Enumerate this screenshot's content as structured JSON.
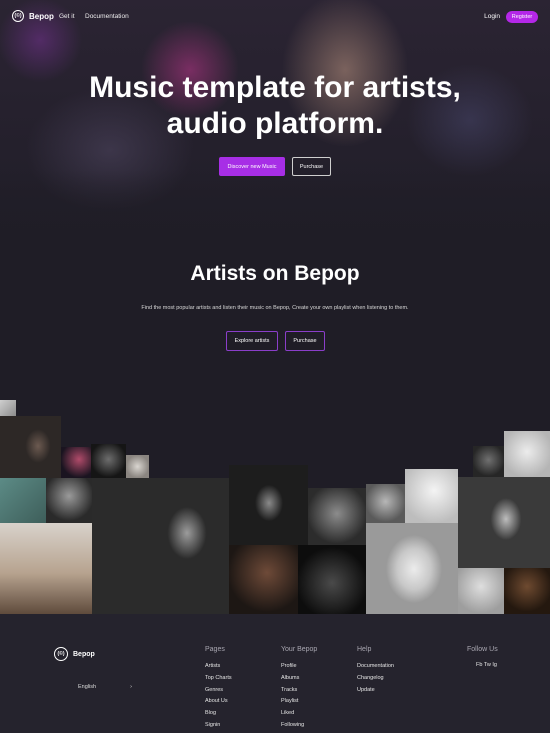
{
  "brand": {
    "name": "Bepop",
    "mark": "(©)"
  },
  "nav": {
    "links": [
      "Get it",
      "Documentation"
    ],
    "login": "Login",
    "register": "Register"
  },
  "hero": {
    "title_line1": "Music template for artists,",
    "title_line2": "audio platform.",
    "primary_button": "Discover new Music",
    "secondary_button": "Purchase"
  },
  "artists": {
    "title": "Artists on Bepop",
    "description": "Find the most popular artists and listen their music on Bepop, Create your own playlist when listening to them.",
    "explore_button": "Explore artists",
    "purchase_button": "Purchase"
  },
  "footer": {
    "brand": "Bepop",
    "language": "English",
    "columns": [
      {
        "title": "Pages",
        "links": [
          "Artists",
          "Top Charts",
          "Genres",
          "About Us",
          "Blog",
          "Signin"
        ]
      },
      {
        "title": "Your Bepop",
        "links": [
          "Profile",
          "Albums",
          "Tracks",
          "Playlist",
          "Liked",
          "Following"
        ]
      },
      {
        "title": "Help",
        "links": [
          "Documentation",
          "Changelog",
          "Update"
        ]
      },
      {
        "title": "Follow Us",
        "links": [
          "Fb Tw Ig"
        ]
      }
    ]
  },
  "colors": {
    "accent": "#a72ee6",
    "register": "#b427e8",
    "background": "#1f1d26",
    "footer": "#25232d"
  }
}
